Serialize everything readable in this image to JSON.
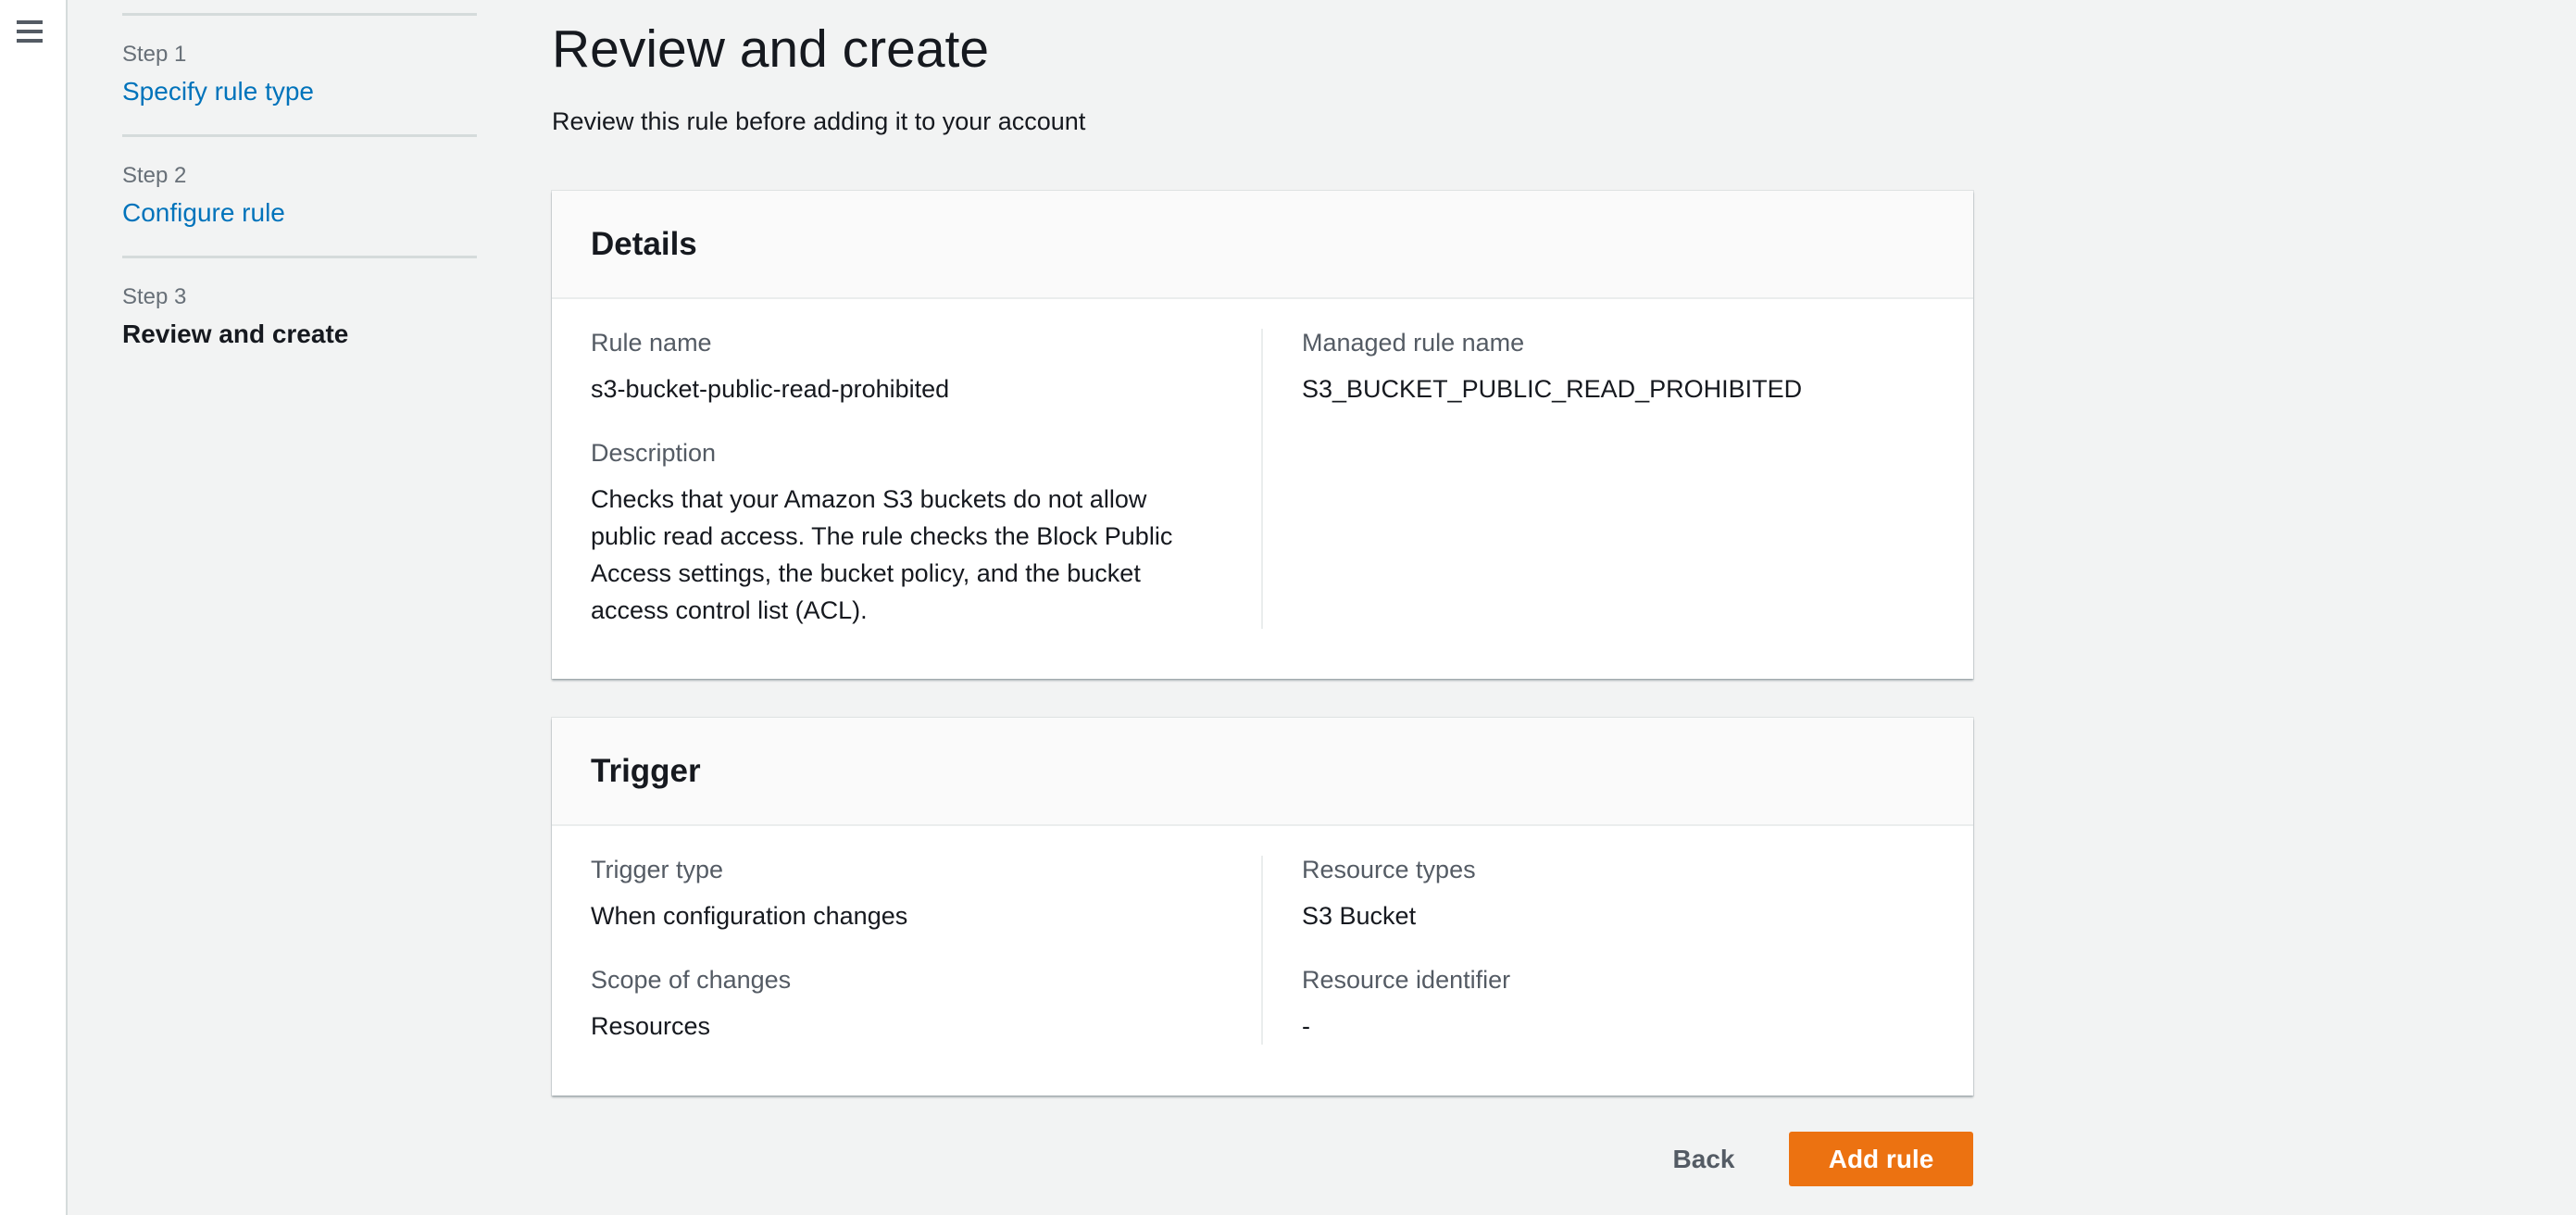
{
  "nav": {
    "steps": [
      {
        "num": "Step 1",
        "label": "Specify rule type"
      },
      {
        "num": "Step 2",
        "label": "Configure rule"
      },
      {
        "num": "Step 3",
        "label": "Review and create"
      }
    ]
  },
  "page": {
    "title": "Review and create",
    "subtitle": "Review this rule before adding it to your account"
  },
  "details": {
    "title": "Details",
    "rule_name_label": "Rule name",
    "rule_name": "s3-bucket-public-read-prohibited",
    "description_label": "Description",
    "description": "Checks that your Amazon S3 buckets do not allow public read access. The rule checks the Block Public Access settings, the bucket policy, and the bucket access control list (ACL).",
    "managed_rule_label": "Managed rule name",
    "managed_rule": "S3_BUCKET_PUBLIC_READ_PROHIBITED"
  },
  "trigger": {
    "title": "Trigger",
    "type_label": "Trigger type",
    "type": "When configuration changes",
    "scope_label": "Scope of changes",
    "scope": "Resources",
    "resource_types_label": "Resource types",
    "resource_types": "S3 Bucket",
    "resource_id_label": "Resource identifier",
    "resource_id": "-"
  },
  "actions": {
    "back": "Back",
    "add": "Add rule"
  },
  "colors": {
    "primary": "#ec7211",
    "link": "#0073bb"
  }
}
